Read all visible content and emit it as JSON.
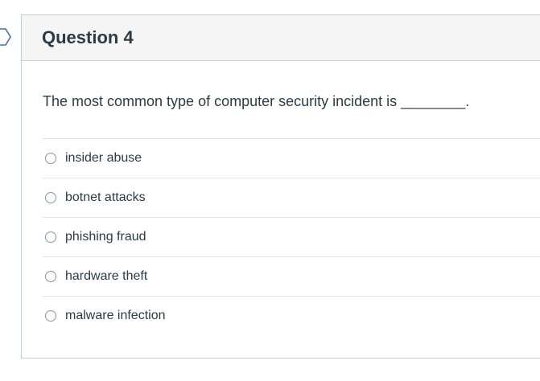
{
  "question": {
    "title": "Question 4",
    "text": "The most common type of computer security incident is ________.",
    "answers": [
      {
        "label": "insider abuse"
      },
      {
        "label": "botnet attacks"
      },
      {
        "label": "phishing fraud"
      },
      {
        "label": "hardware theft"
      },
      {
        "label": "malware infection"
      }
    ]
  },
  "icons": {
    "flag": "question-flag-icon",
    "radio": "radio-unselected-icon"
  },
  "colors": {
    "header_bg": "#f5f5f5",
    "border": "#c7cdd1",
    "text": "#2d3b45"
  }
}
